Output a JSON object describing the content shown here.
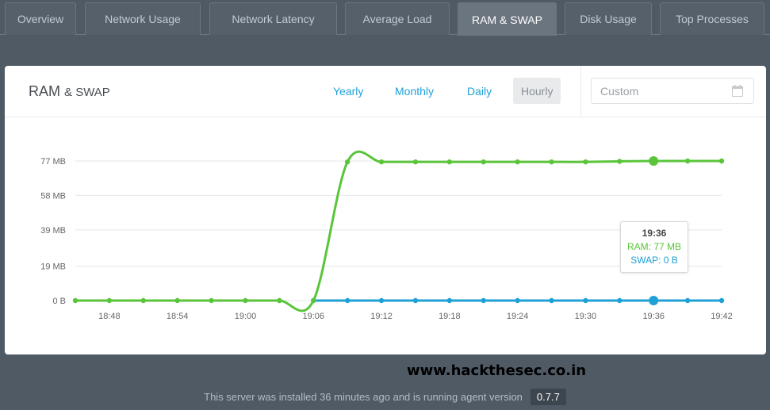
{
  "tabs": [
    {
      "label": "Overview",
      "active": false
    },
    {
      "label": "Network Usage",
      "active": false
    },
    {
      "label": "Network Latency",
      "active": false
    },
    {
      "label": "Average Load",
      "active": false
    },
    {
      "label": "RAM & SWAP",
      "active": true
    },
    {
      "label": "Disk Usage",
      "active": false
    },
    {
      "label": "Top Processes",
      "active": false
    }
  ],
  "card": {
    "title_main": "RAM",
    "title_sub": "& SWAP",
    "ranges": [
      {
        "label": "Yearly",
        "active": false
      },
      {
        "label": "Monthly",
        "active": false
      },
      {
        "label": "Daily",
        "active": false
      },
      {
        "label": "Hourly",
        "active": true
      }
    ],
    "custom_placeholder": "Custom",
    "custom_icon": "calendar-icon"
  },
  "chart_data": {
    "type": "line",
    "title": "",
    "xlabel": "",
    "ylabel": "",
    "x_tick_labels": [
      "18:48",
      "18:54",
      "19:00",
      "19:06",
      "19:12",
      "19:18",
      "19:24",
      "19:30",
      "19:36",
      "19:42"
    ],
    "y_tick_labels": [
      "0 B",
      "19 MB",
      "39 MB",
      "58 MB",
      "77 MB"
    ],
    "y_tick_values": [
      0,
      19,
      39,
      58,
      77
    ],
    "y_unit": "MB",
    "ylim": [
      0,
      77
    ],
    "grid": true,
    "x": [
      "18:45",
      "18:48",
      "18:51",
      "18:54",
      "18:57",
      "19:00",
      "19:03",
      "19:06",
      "19:09",
      "19:12",
      "19:15",
      "19:18",
      "19:21",
      "19:24",
      "19:27",
      "19:30",
      "19:33",
      "19:36",
      "19:39",
      "19:42"
    ],
    "series": [
      {
        "name": "RAM",
        "color": "#5ac53a",
        "values": [
          0,
          0,
          0,
          0,
          0,
          0,
          0,
          0,
          76.5,
          76.5,
          76.5,
          76.5,
          76.5,
          76.5,
          76.5,
          76.5,
          76.8,
          77,
          77,
          77
        ]
      },
      {
        "name": "SWAP",
        "color": "#1fa0d6",
        "values": [
          0,
          0,
          0,
          0,
          0,
          0,
          0,
          0,
          0,
          0,
          0,
          0,
          0,
          0,
          0,
          0,
          0,
          0,
          0,
          0
        ]
      }
    ],
    "highlight_index": 17,
    "tooltip": {
      "time": "19:36",
      "ram": "RAM: 77 MB",
      "swap": "SWAP: 0 B"
    }
  },
  "watermark": "www.hackthesec.co.in",
  "footer": {
    "text": "This server was installed 36 minutes ago and is running agent version",
    "version": "0.7.7"
  }
}
